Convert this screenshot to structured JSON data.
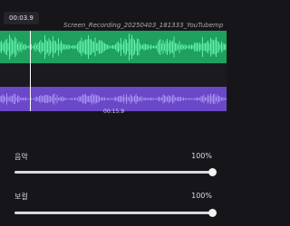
{
  "timeline": {
    "current_time": "00:03.9",
    "file_name": "Screen_Recording_20250403_181333_YouTubemp",
    "audio_time": "00:15.9"
  },
  "colors": {
    "video_track": "#1fa05e",
    "audio_track": "#6a48c8",
    "background": "#16161a"
  },
  "mixer": {
    "music": {
      "label": "음악",
      "value_text": "100%",
      "level": 1.0
    },
    "vocal": {
      "label": "보컬",
      "value_text": "100%",
      "level": 1.0
    }
  }
}
